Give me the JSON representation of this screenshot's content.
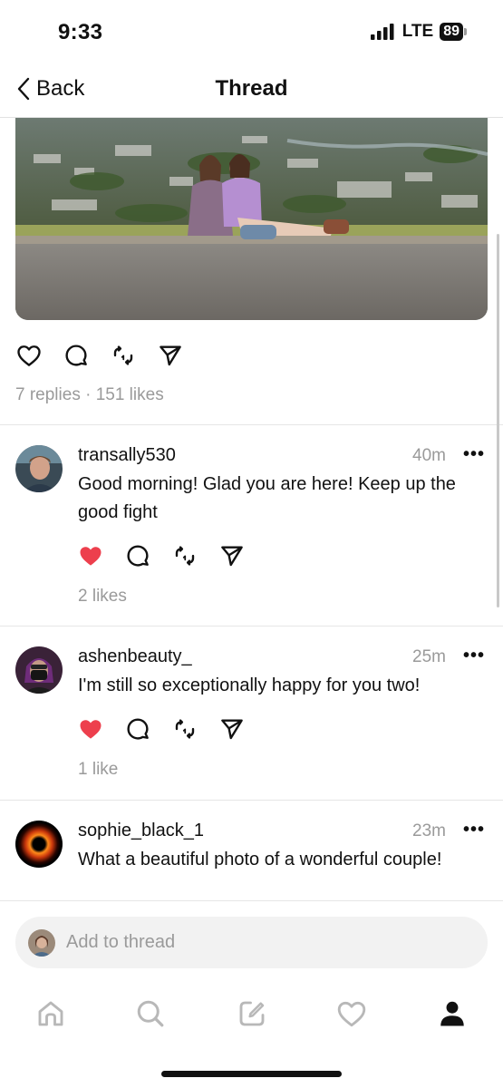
{
  "status_bar": {
    "time": "9:33",
    "network": "LTE",
    "battery": "89"
  },
  "nav": {
    "back_label": "Back",
    "title": "Thread"
  },
  "post": {
    "stats": "7 replies · 151 likes"
  },
  "replies": [
    {
      "username": "transally530",
      "time": "40m",
      "more": "•••",
      "text": "Good morning! Glad you are here! Keep up the good fight",
      "likes": "2 likes",
      "liked": true
    },
    {
      "username": "ashenbeauty_",
      "time": "25m",
      "more": "•••",
      "text": "I'm still so exceptionally happy for you two!",
      "likes": "1 like",
      "liked": true
    },
    {
      "username": "sophie_black_1",
      "time": "23m",
      "more": "•••",
      "text": "What a beautiful photo of a wonderful couple!"
    }
  ],
  "compose": {
    "placeholder": "Add to thread"
  },
  "colors": {
    "like_red": "#ed3f4d",
    "muted_text": "#9a9a9a"
  }
}
